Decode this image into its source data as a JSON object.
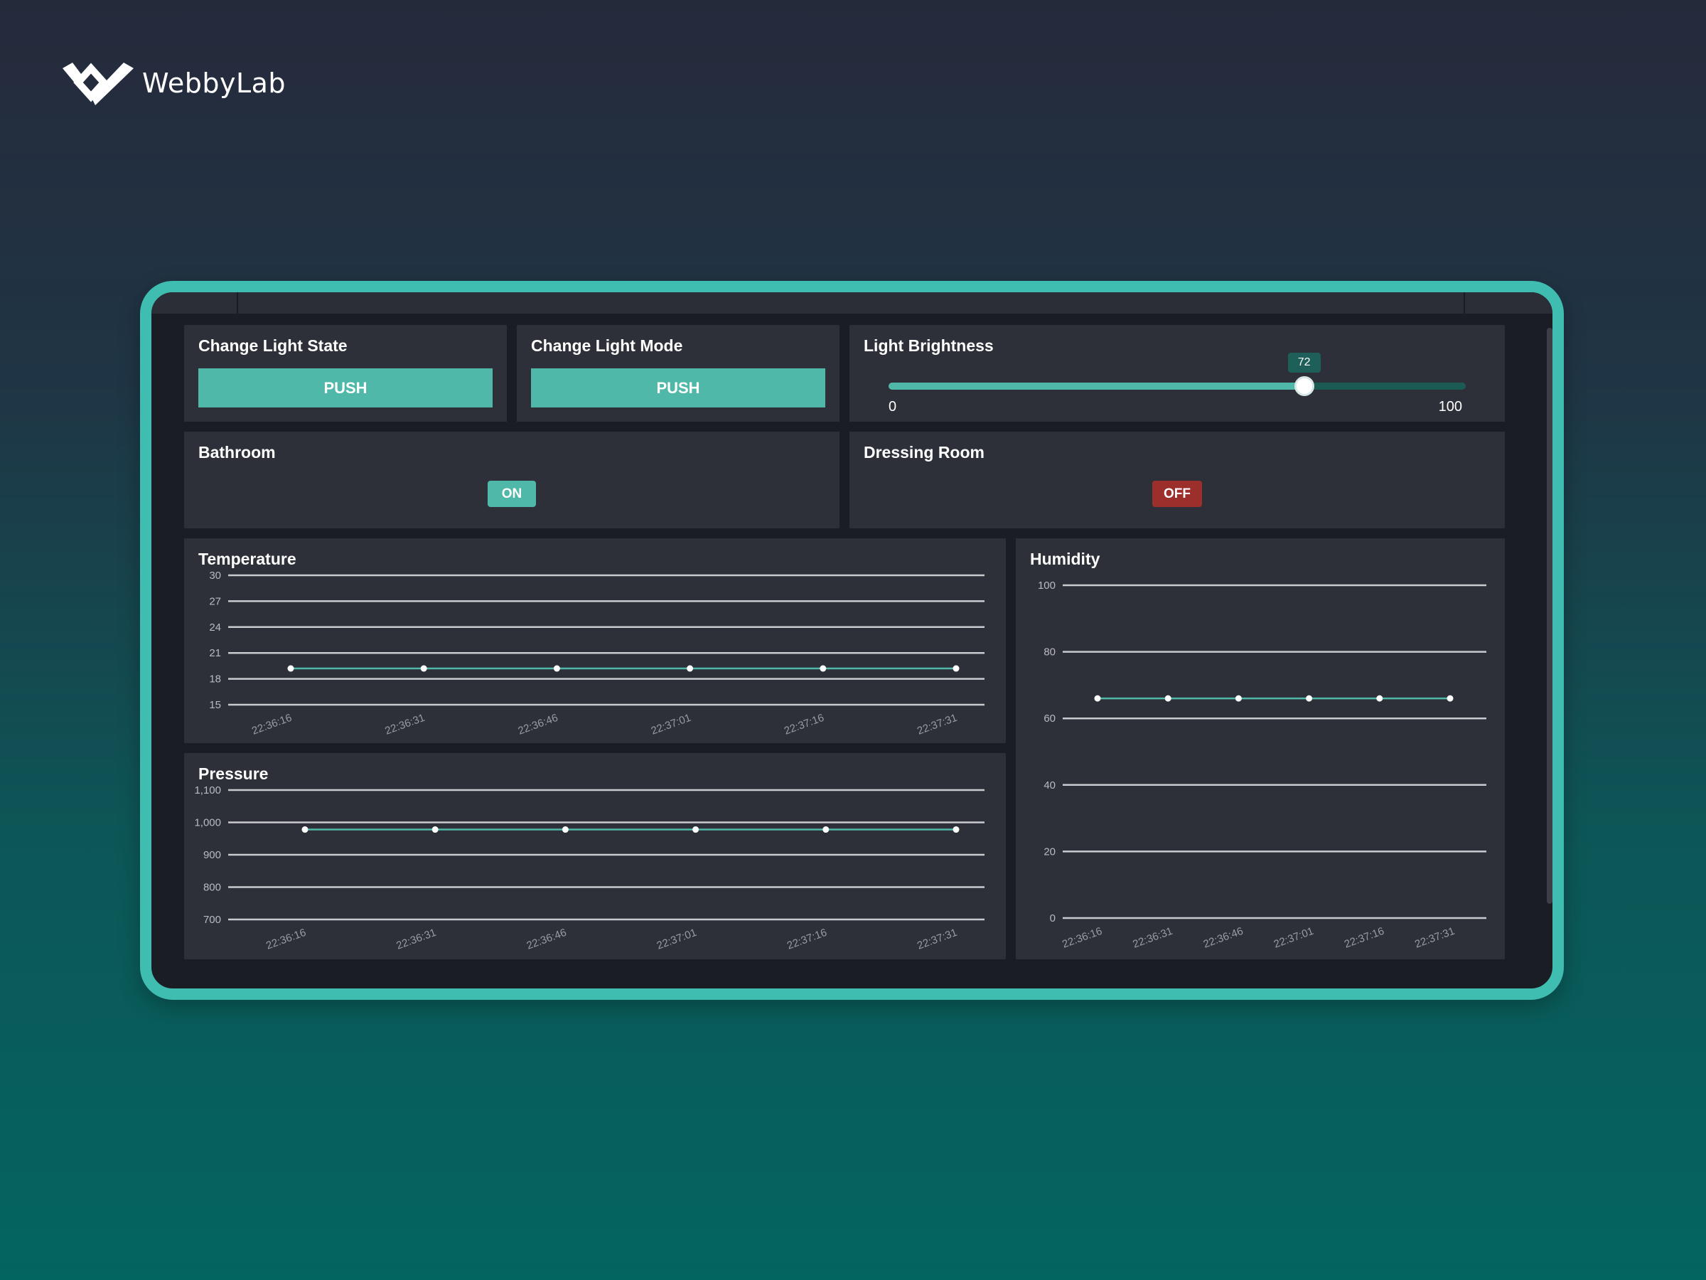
{
  "brand": {
    "name": "WebbyLab",
    "logo_icon": "webbylab-logo-icon"
  },
  "controls": {
    "light_state": {
      "title": "Change Light State",
      "button": "PUSH"
    },
    "light_mode": {
      "title": "Change Light Mode",
      "button": "PUSH"
    },
    "brightness": {
      "title": "Light Brightness",
      "value": 72,
      "value_label": "72",
      "min_label": "0",
      "max_label": "100",
      "min": 0,
      "max": 100
    }
  },
  "rooms": {
    "bathroom": {
      "title": "Bathroom",
      "state": "ON",
      "color": "#4fb8a8"
    },
    "dressing_room": {
      "title": "Dressing Room",
      "state": "OFF",
      "color": "#9c2f2c"
    }
  },
  "colors": {
    "accent": "#4fb8a8",
    "frame": "#3fbdb1",
    "panel": "#2d3038",
    "off": "#9c2f2c"
  },
  "chart_data": [
    {
      "type": "line",
      "title": "Temperature",
      "x": [
        "22:36:16",
        "22:36:31",
        "22:36:46",
        "22:37:01",
        "22:37:16",
        "22:37:31"
      ],
      "series": [
        {
          "values": [
            19.2,
            19.2,
            19.2,
            19.2,
            19.2,
            19.2
          ]
        }
      ],
      "ylim": [
        15,
        30
      ],
      "yticks": [
        "15",
        "18",
        "21",
        "24",
        "27",
        "30"
      ],
      "grid": true
    },
    {
      "type": "line",
      "title": "Pressure",
      "x": [
        "22:36:16",
        "22:36:31",
        "22:36:46",
        "22:37:01",
        "22:37:16",
        "22:37:31"
      ],
      "series": [
        {
          "values": [
            978,
            978,
            978,
            978,
            978,
            978
          ]
        }
      ],
      "ylim": [
        700,
        1100
      ],
      "yticks": [
        "700",
        "800",
        "900",
        "1,000",
        "1,100"
      ],
      "grid": true
    },
    {
      "type": "line",
      "title": "Humidity",
      "x": [
        "22:36:16",
        "22:36:31",
        "22:36:46",
        "22:37:01",
        "22:37:16",
        "22:37:31"
      ],
      "series": [
        {
          "values": [
            66,
            66,
            66,
            66,
            66,
            66
          ]
        }
      ],
      "ylim": [
        0,
        100
      ],
      "yticks": [
        "0",
        "20",
        "40",
        "60",
        "80",
        "100"
      ],
      "grid": true
    }
  ]
}
